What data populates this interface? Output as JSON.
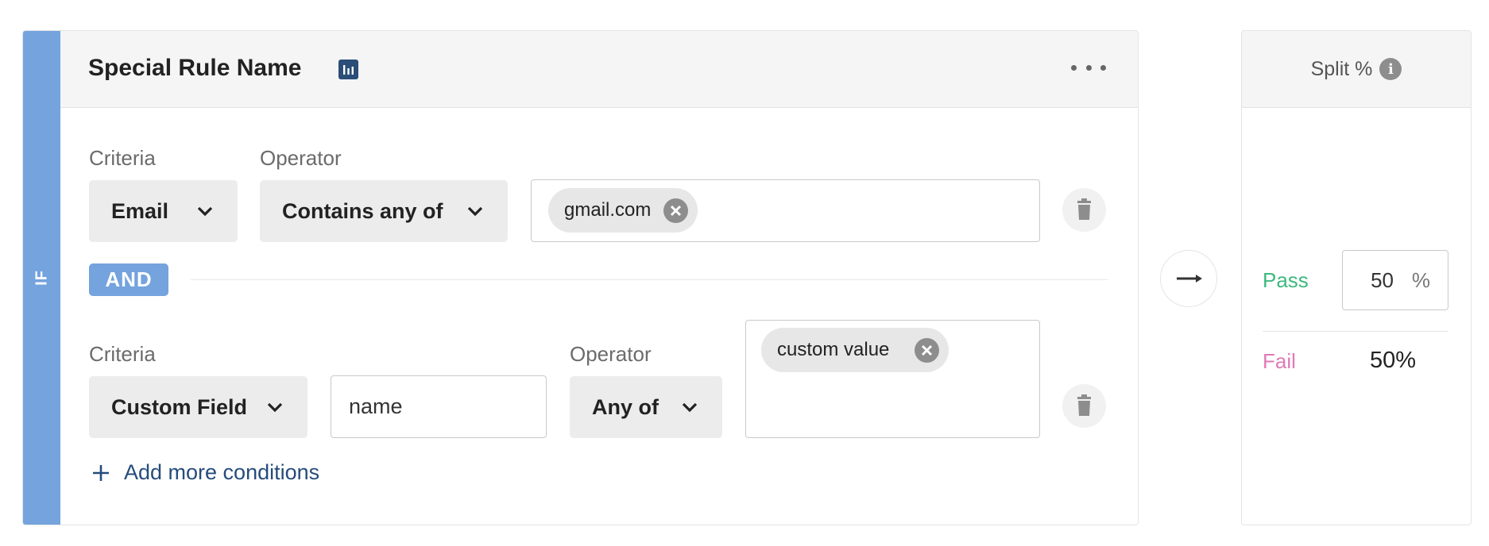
{
  "rule": {
    "if_label": "IF",
    "name": "Special Rule Name",
    "and_label": "AND",
    "add_more_label": "Add more conditions",
    "conditions": [
      {
        "criteria_label": "Criteria",
        "criteria_value": "Email",
        "operator_label": "Operator",
        "operator_value": "Contains any of",
        "tags": [
          "gmail.com"
        ]
      },
      {
        "criteria_label": "Criteria",
        "criteria_value": "Custom Field",
        "field_name_value": "name",
        "operator_label": "Operator",
        "operator_value": "Any of",
        "tags": [
          "custom value"
        ]
      }
    ]
  },
  "split": {
    "title": "Split %",
    "pass_label": "Pass",
    "pass_value": "50",
    "pass_unit": "%",
    "fail_label": "Fail",
    "fail_value": "50%"
  },
  "colors": {
    "if_bar": "#74a3de",
    "title_icon": "#2b4d78",
    "pass": "#3fb97f",
    "fail": "#e07ab5",
    "link": "#254c7c"
  }
}
